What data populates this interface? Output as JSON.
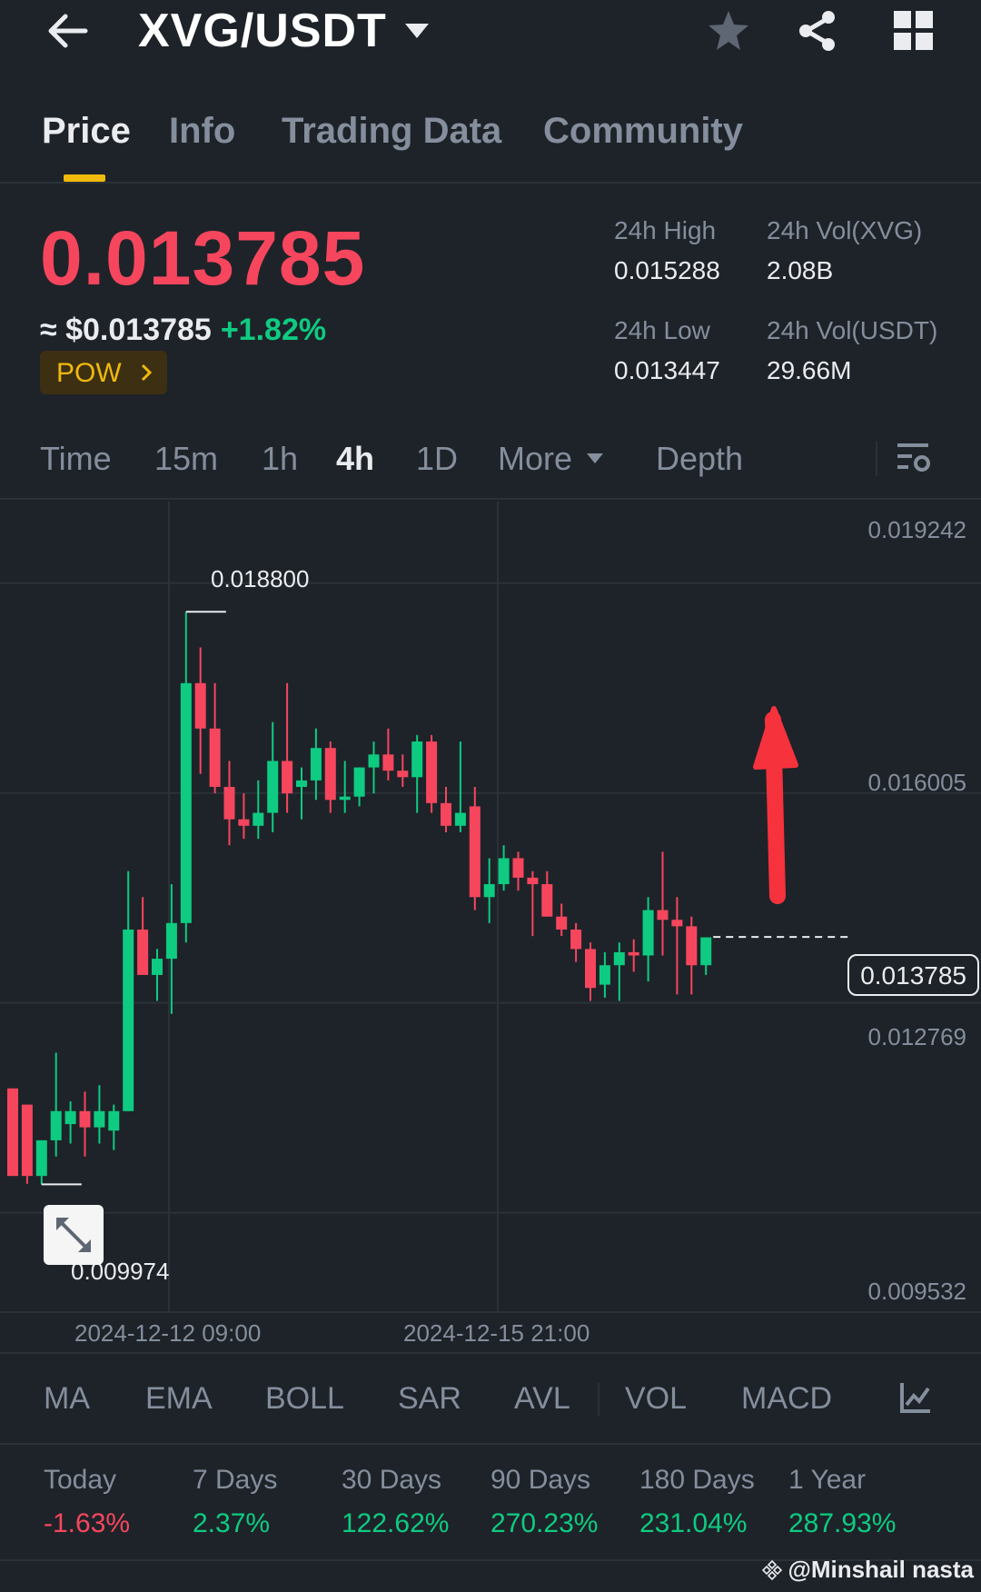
{
  "header": {
    "pair": "XVG/USDT",
    "icons": [
      "back-arrow-icon",
      "caret-down-icon",
      "star-icon",
      "share-icon",
      "grid-icon"
    ]
  },
  "tabs": [
    {
      "label": "Price",
      "active": true
    },
    {
      "label": "Info",
      "active": false
    },
    {
      "label": "Trading Data",
      "active": false
    },
    {
      "label": "Community",
      "active": false
    }
  ],
  "ticker": {
    "last_price": "0.013785",
    "usd_price": "≈ $0.013785",
    "change": "+1.82%",
    "tag": "POW",
    "high_label": "24h High",
    "high_value": "0.015288",
    "vol_base_label": "24h Vol(XVG)",
    "vol_base_value": "2.08B",
    "low_label": "24h Low",
    "low_value": "0.013447",
    "vol_quote_label": "24h Vol(USDT)",
    "vol_quote_value": "29.66M"
  },
  "intervals": {
    "items": [
      "Time",
      "15m",
      "1h",
      "4h",
      "1D",
      "More",
      "Depth"
    ],
    "active": "4h"
  },
  "chart": {
    "price_axis": [
      "0.019242",
      "0.016005",
      "0.012769",
      "0.009532"
    ],
    "current_price": "0.013785",
    "high_marker": "0.018800",
    "low_marker": "0.009974",
    "time_axis": [
      "2024-12-12 09:00",
      "2024-12-15 21:00"
    ],
    "up_color": "#0ecb81",
    "down_color": "#f6465d"
  },
  "chart_data": {
    "type": "candlestick",
    "interval": "4h",
    "ylim": [
      0.008,
      0.0205
    ],
    "yticks": [
      0.019242,
      0.016005,
      0.012769,
      0.009532
    ],
    "candles": [
      {
        "o": 0.01145,
        "h": 0.01145,
        "l": 0.0101,
        "c": 0.0101
      },
      {
        "o": 0.0112,
        "h": 0.0112,
        "l": 0.00998,
        "c": 0.0101
      },
      {
        "o": 0.0101,
        "h": 0.01065,
        "l": 0.00997,
        "c": 0.01065
      },
      {
        "o": 0.01065,
        "h": 0.012,
        "l": 0.0104,
        "c": 0.0111
      },
      {
        "o": 0.0109,
        "h": 0.01125,
        "l": 0.0106,
        "c": 0.0111
      },
      {
        "o": 0.0111,
        "h": 0.0114,
        "l": 0.0104,
        "c": 0.01085
      },
      {
        "o": 0.01085,
        "h": 0.0115,
        "l": 0.0106,
        "c": 0.0111
      },
      {
        "o": 0.0108,
        "h": 0.0112,
        "l": 0.0105,
        "c": 0.0111
      },
      {
        "o": 0.0111,
        "h": 0.0148,
        "l": 0.0111,
        "c": 0.0139
      },
      {
        "o": 0.0139,
        "h": 0.0144,
        "l": 0.0134,
        "c": 0.0132
      },
      {
        "o": 0.0132,
        "h": 0.0136,
        "l": 0.0128,
        "c": 0.01345
      },
      {
        "o": 0.01345,
        "h": 0.0146,
        "l": 0.0126,
        "c": 0.014
      },
      {
        "o": 0.014,
        "h": 0.0188,
        "l": 0.0137,
        "c": 0.0177
      },
      {
        "o": 0.0177,
        "h": 0.01825,
        "l": 0.0163,
        "c": 0.017
      },
      {
        "o": 0.017,
        "h": 0.0177,
        "l": 0.016,
        "c": 0.0161
      },
      {
        "o": 0.0161,
        "h": 0.0165,
        "l": 0.0152,
        "c": 0.0156
      },
      {
        "o": 0.0156,
        "h": 0.016,
        "l": 0.0153,
        "c": 0.0155
      },
      {
        "o": 0.0155,
        "h": 0.0162,
        "l": 0.0153,
        "c": 0.0157
      },
      {
        "o": 0.0157,
        "h": 0.0171,
        "l": 0.0154,
        "c": 0.0165
      },
      {
        "o": 0.0165,
        "h": 0.0177,
        "l": 0.0157,
        "c": 0.016
      },
      {
        "o": 0.0161,
        "h": 0.0164,
        "l": 0.0156,
        "c": 0.0162
      },
      {
        "o": 0.0162,
        "h": 0.017,
        "l": 0.0159,
        "c": 0.0167
      },
      {
        "o": 0.0167,
        "h": 0.0168,
        "l": 0.0157,
        "c": 0.0159
      },
      {
        "o": 0.0159,
        "h": 0.0165,
        "l": 0.0157,
        "c": 0.01595
      },
      {
        "o": 0.01595,
        "h": 0.0164,
        "l": 0.0158,
        "c": 0.0164
      },
      {
        "o": 0.0164,
        "h": 0.0168,
        "l": 0.016,
        "c": 0.0166
      },
      {
        "o": 0.0166,
        "h": 0.017,
        "l": 0.0162,
        "c": 0.01635
      },
      {
        "o": 0.01635,
        "h": 0.0166,
        "l": 0.0161,
        "c": 0.01625
      },
      {
        "o": 0.01625,
        "h": 0.0169,
        "l": 0.0157,
        "c": 0.0168
      },
      {
        "o": 0.0168,
        "h": 0.0169,
        "l": 0.0157,
        "c": 0.01585
      },
      {
        "o": 0.01585,
        "h": 0.0161,
        "l": 0.0154,
        "c": 0.0155
      },
      {
        "o": 0.0155,
        "h": 0.0168,
        "l": 0.0154,
        "c": 0.0157
      },
      {
        "o": 0.0158,
        "h": 0.0161,
        "l": 0.0142,
        "c": 0.0144
      },
      {
        "o": 0.0144,
        "h": 0.015,
        "l": 0.014,
        "c": 0.0146
      },
      {
        "o": 0.0146,
        "h": 0.0152,
        "l": 0.0145,
        "c": 0.015
      },
      {
        "o": 0.015,
        "h": 0.0151,
        "l": 0.0145,
        "c": 0.0147
      },
      {
        "o": 0.0147,
        "h": 0.0148,
        "l": 0.0138,
        "c": 0.0146
      },
      {
        "o": 0.0146,
        "h": 0.0148,
        "l": 0.0141,
        "c": 0.0141
      },
      {
        "o": 0.0141,
        "h": 0.0143,
        "l": 0.0138,
        "c": 0.0139
      },
      {
        "o": 0.0139,
        "h": 0.014,
        "l": 0.0134,
        "c": 0.0136
      },
      {
        "o": 0.0136,
        "h": 0.0137,
        "l": 0.0128,
        "c": 0.013
      },
      {
        "o": 0.01305,
        "h": 0.01355,
        "l": 0.01285,
        "c": 0.01335
      },
      {
        "o": 0.01335,
        "h": 0.0137,
        "l": 0.0128,
        "c": 0.01355
      },
      {
        "o": 0.01355,
        "h": 0.01375,
        "l": 0.01325,
        "c": 0.0135
      },
      {
        "o": 0.0135,
        "h": 0.0144,
        "l": 0.0131,
        "c": 0.0142
      },
      {
        "o": 0.0142,
        "h": 0.0151,
        "l": 0.0135,
        "c": 0.01405
      },
      {
        "o": 0.01405,
        "h": 0.0144,
        "l": 0.0129,
        "c": 0.01395
      },
      {
        "o": 0.01395,
        "h": 0.0141,
        "l": 0.0129,
        "c": 0.01335
      },
      {
        "o": 0.01335,
        "h": 0.0137,
        "l": 0.0132,
        "c": 0.01378
      }
    ]
  },
  "indicators": [
    "MA",
    "EMA",
    "BOLL",
    "SAR",
    "AVL",
    "VOL",
    "MACD"
  ],
  "performance": [
    {
      "label": "Today",
      "value": "-1.63%",
      "negative": true
    },
    {
      "label": "7 Days",
      "value": "2.37%",
      "negative": false
    },
    {
      "label": "30 Days",
      "value": "122.62%",
      "negative": false
    },
    {
      "label": "90 Days",
      "value": "270.23%",
      "negative": false
    },
    {
      "label": "180 Days",
      "value": "231.04%",
      "negative": false
    },
    {
      "label": "1 Year",
      "value": "287.93%",
      "negative": false
    }
  ],
  "watermark": "@Minshail nasta"
}
